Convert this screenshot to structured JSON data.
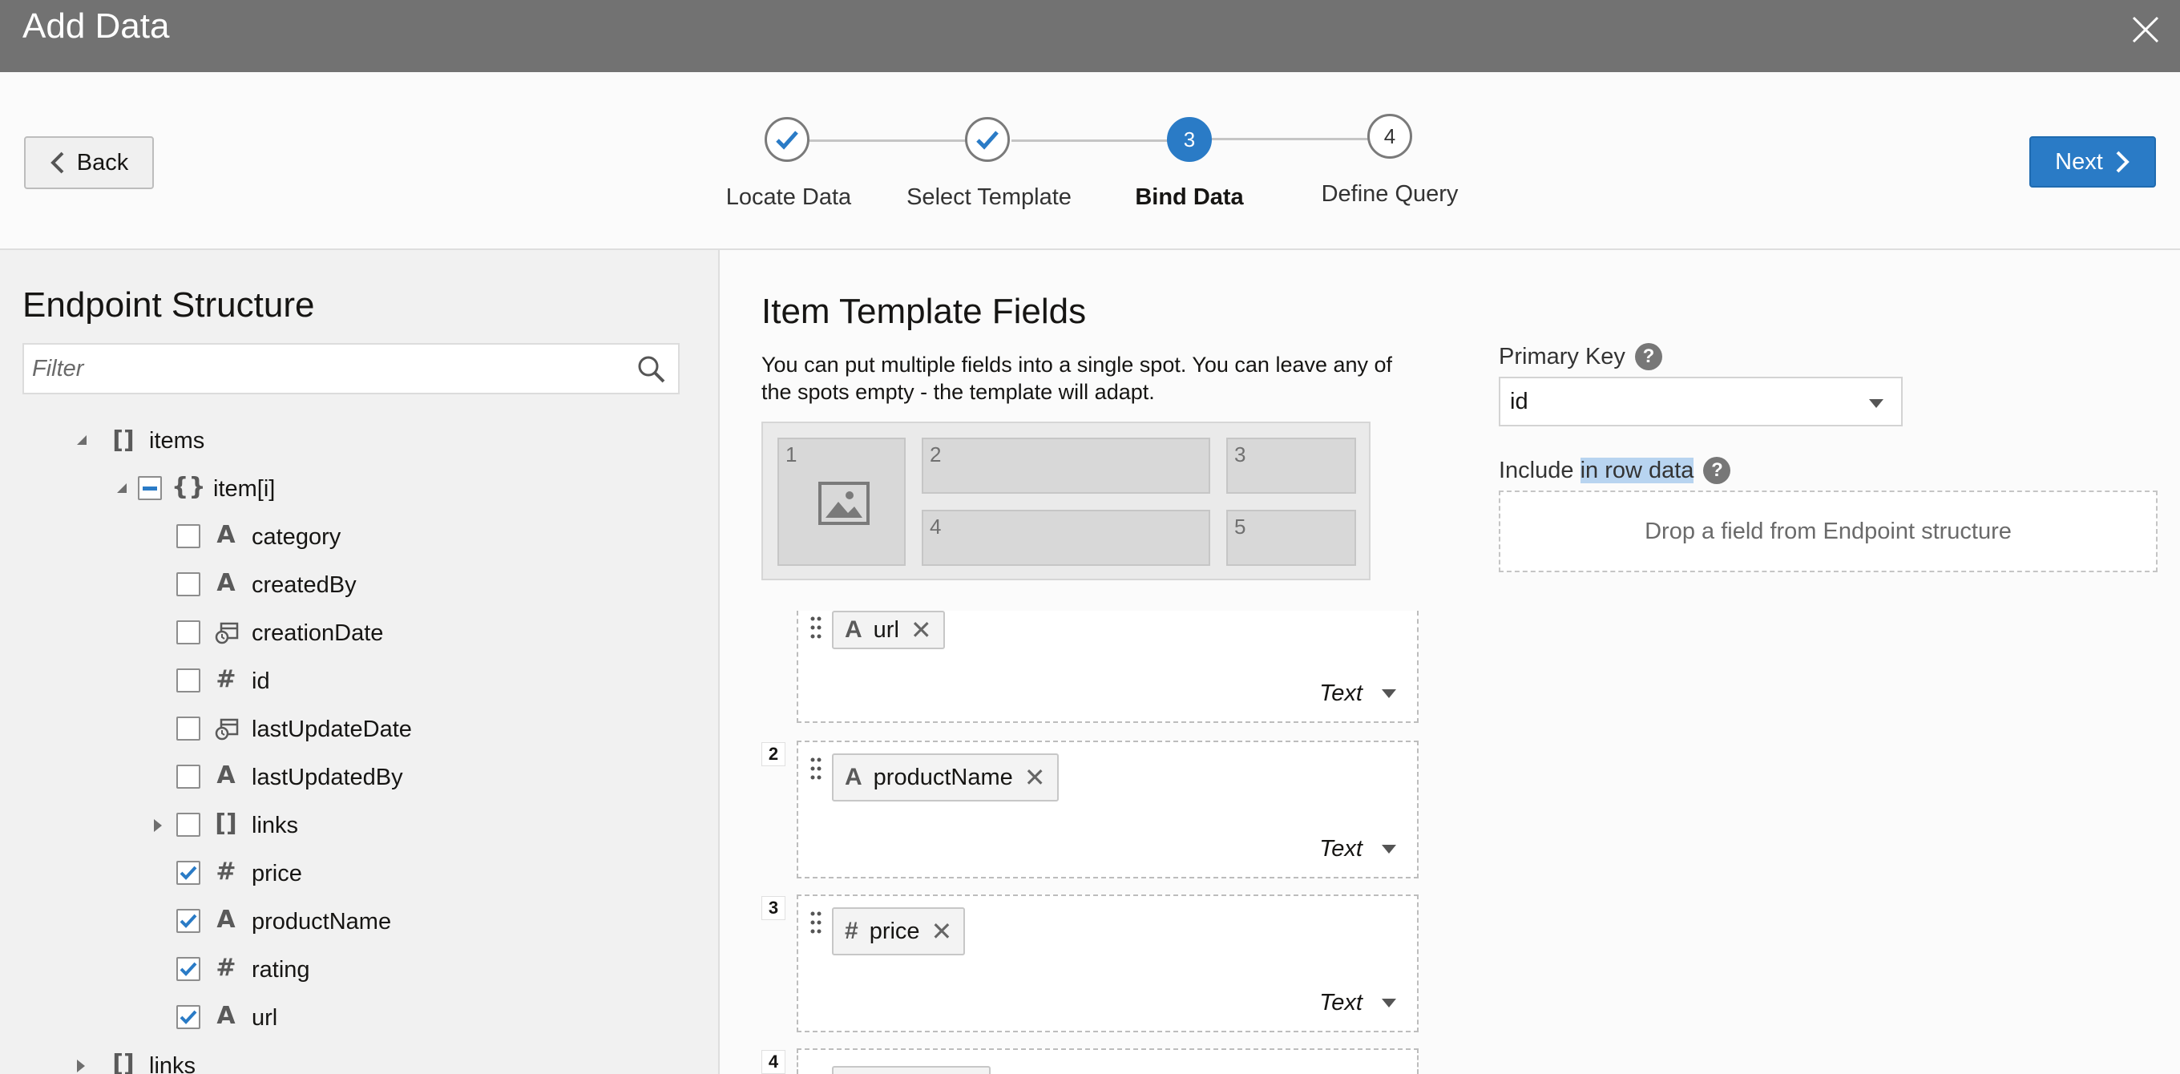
{
  "window": {
    "title": "Add Data"
  },
  "toolbar": {
    "back_label": "Back",
    "next_label": "Next"
  },
  "steps": [
    {
      "label": "Locate Data",
      "state": "done"
    },
    {
      "label": "Select Template",
      "state": "done"
    },
    {
      "number": "3",
      "label": "Bind Data",
      "state": "active"
    },
    {
      "number": "4",
      "label": "Define Query",
      "state": "pending"
    }
  ],
  "endpoint": {
    "title": "Endpoint Structure",
    "filter_placeholder": "Filter",
    "tree": [
      {
        "label": "items",
        "type": "array",
        "expanded": true
      },
      {
        "label": "item[i]",
        "type": "object",
        "expanded": true,
        "checkbox": "partial"
      },
      {
        "label": "category",
        "type": "text",
        "checked": false
      },
      {
        "label": "createdBy",
        "type": "text",
        "checked": false
      },
      {
        "label": "creationDate",
        "type": "date",
        "checked": false
      },
      {
        "label": "id",
        "type": "number",
        "checked": false
      },
      {
        "label": "lastUpdateDate",
        "type": "date",
        "checked": false
      },
      {
        "label": "lastUpdatedBy",
        "type": "text",
        "checked": false
      },
      {
        "label": "links",
        "type": "array",
        "checked": false,
        "expanded": false
      },
      {
        "label": "price",
        "type": "number",
        "checked": true
      },
      {
        "label": "productName",
        "type": "text",
        "checked": true
      },
      {
        "label": "rating",
        "type": "number",
        "checked": true
      },
      {
        "label": "url",
        "type": "text",
        "checked": true
      },
      {
        "label": "links",
        "type": "array",
        "expanded": false
      }
    ]
  },
  "template": {
    "title": "Item Template Fields",
    "description": "You can put multiple fields into a single spot. You can leave any of the spots empty - the template will adapt.",
    "spots": [
      "1",
      "2",
      "3",
      "4",
      "5"
    ],
    "bindings": [
      {
        "slot": "",
        "field": "url",
        "type_icon": "A",
        "display": "Text"
      },
      {
        "slot": "2",
        "field": "productName",
        "type_icon": "A",
        "display": "Text"
      },
      {
        "slot": "3",
        "field": "price",
        "type_icon": "#",
        "display": "Text"
      },
      {
        "slot": "4"
      }
    ]
  },
  "primary_key": {
    "label": "Primary Key",
    "help": "?",
    "value": "id"
  },
  "include": {
    "label_prefix": "Include ",
    "label_highlight": "in row data",
    "help": "?",
    "dropzone_text": "Drop a field from Endpoint structure"
  },
  "colors": {
    "accent": "#2a7bc6",
    "titlebar": "#727272"
  }
}
